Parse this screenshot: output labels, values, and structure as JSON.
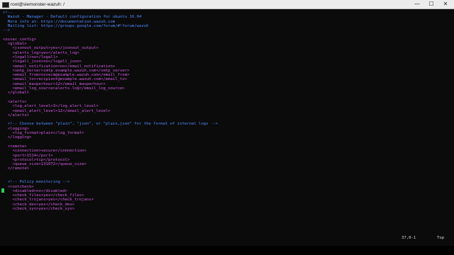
{
  "window": {
    "title": "root@siemonster-wazuh: /",
    "minimize_glyph": "—",
    "maximize_glyph": "☐",
    "close_glyph": "✕"
  },
  "terminal": {
    "lines": [
      {
        "t": "<!--",
        "c": "comment"
      },
      {
        "t": "  Wazuh - Manager - Default configuration for ubuntu 16.04",
        "c": "comment"
      },
      {
        "t": "  More info at: https://documentation.wazuh.com",
        "c": "comment"
      },
      {
        "t": "  Mailing list: https://groups.google.com/forum/#!forum/wazuh",
        "c": "comment"
      },
      {
        "t": "-->",
        "c": "comment"
      },
      {
        "t": "",
        "c": "text"
      },
      {
        "t": "<ossec_config>",
        "c": "tag"
      },
      {
        "t": "  <global>",
        "c": "tag"
      },
      {
        "t": "    <jsonout_output>yes</jsonout_output>",
        "c": "tag"
      },
      {
        "t": "    <alerts_log>yes</alerts_log>",
        "c": "tag"
      },
      {
        "t": "    <logall>no</logall>",
        "c": "tag"
      },
      {
        "t": "    <logall_json>no</logall_json>",
        "c": "tag"
      },
      {
        "t": "    <email_notification>no</email_notification>",
        "c": "tag"
      },
      {
        "t": "    <smtp_server>smtp.example.wazuh.com</smtp_server>",
        "c": "tag"
      },
      {
        "t": "    <email_from>ossecm@example.wazuh.com</email_from>",
        "c": "tag"
      },
      {
        "t": "    <email_to>recipient@example.wazuh.com</email_to>",
        "c": "tag"
      },
      {
        "t": "    <email_maxperhour>12</email_maxperhour>",
        "c": "tag"
      },
      {
        "t": "    <email_log_source>alerts.log</email_log_source>",
        "c": "tag"
      },
      {
        "t": "  </global>",
        "c": "tag"
      },
      {
        "t": "",
        "c": "text"
      },
      {
        "t": "  <alerts>",
        "c": "tag"
      },
      {
        "t": "    <log_alert_level>3</log_alert_level>",
        "c": "tag"
      },
      {
        "t": "    <email_alert_level>12</email_alert_level>",
        "c": "tag"
      },
      {
        "t": "  </alerts>",
        "c": "tag"
      },
      {
        "t": "",
        "c": "text"
      },
      {
        "t": "  <!-- Choose between \"plain\", \"json\", or \"plain,json\" for the format of internal logs -->",
        "c": "comment"
      },
      {
        "t": "  <logging>",
        "c": "tag"
      },
      {
        "t": "    <log_format>plain</log_format>",
        "c": "tag"
      },
      {
        "t": "  </logging>",
        "c": "tag"
      },
      {
        "t": "",
        "c": "text"
      },
      {
        "t": "  <remote>",
        "c": "tag"
      },
      {
        "t": "    <connection>secure</connection>",
        "c": "tag"
      },
      {
        "t": "    <port>1514</port>",
        "c": "tag"
      },
      {
        "t": "    <protocol>tcp</protocol>",
        "c": "tag"
      },
      {
        "t": "    <queue_size>131072</queue_size>",
        "c": "tag"
      },
      {
        "t": "  </remote>",
        "c": "tag"
      },
      {
        "t": "",
        "c": "text"
      },
      {
        "t": "",
        "c": "text"
      },
      {
        "t": "  <!-- Policy monitoring -->",
        "c": "comment"
      },
      {
        "t": "  <rootcheck>",
        "c": "tag"
      },
      {
        "t": "    <disabled>no</disabled>",
        "c": "tag"
      },
      {
        "t": "    <check_files>yes</check_files>",
        "c": "tag"
      },
      {
        "t": "    <check_trojans>yes</check_trojans>",
        "c": "tag"
      },
      {
        "t": "    <check_dev>yes</check_dev>",
        "c": "tag"
      },
      {
        "t": "    <check_sys>yes</check_sys>",
        "c": "tag"
      }
    ]
  },
  "status": {
    "position": "37,0-1",
    "scroll": "Top"
  },
  "colors": {
    "comment": "#4f8cff",
    "tag": "#d25be3",
    "text": "#e6e6e6",
    "cursor": "#2ad14f"
  }
}
